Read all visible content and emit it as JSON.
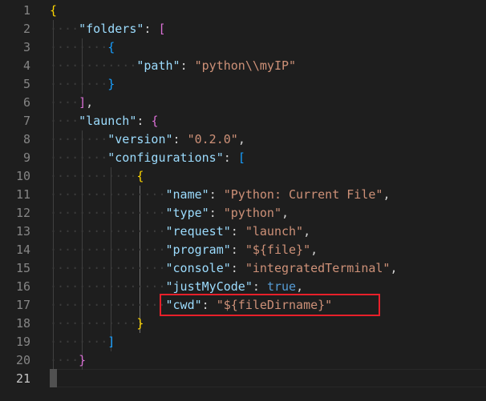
{
  "editor": {
    "lines": [
      {
        "num": "1",
        "tokens": [
          {
            "t": "{",
            "c": "b1"
          }
        ]
      },
      {
        "num": "2",
        "tokens": [
          {
            "t": "····",
            "c": "ws"
          },
          {
            "t": "\"folders\"",
            "c": "key"
          },
          {
            "t": ": ",
            "c": "punc"
          },
          {
            "t": "[",
            "c": "b2"
          }
        ]
      },
      {
        "num": "3",
        "tokens": [
          {
            "t": "········",
            "c": "ws"
          },
          {
            "t": "{",
            "c": "b3"
          }
        ]
      },
      {
        "num": "4",
        "tokens": [
          {
            "t": "············",
            "c": "ws"
          },
          {
            "t": "\"path\"",
            "c": "key"
          },
          {
            "t": ": ",
            "c": "punc"
          },
          {
            "t": "\"python\\\\myIP\"",
            "c": "str"
          }
        ]
      },
      {
        "num": "5",
        "tokens": [
          {
            "t": "········",
            "c": "ws"
          },
          {
            "t": "}",
            "c": "b3"
          }
        ]
      },
      {
        "num": "6",
        "tokens": [
          {
            "t": "····",
            "c": "ws"
          },
          {
            "t": "]",
            "c": "b2"
          },
          {
            "t": ",",
            "c": "punc"
          }
        ]
      },
      {
        "num": "7",
        "tokens": [
          {
            "t": "····",
            "c": "ws"
          },
          {
            "t": "\"launch\"",
            "c": "key"
          },
          {
            "t": ": ",
            "c": "punc"
          },
          {
            "t": "{",
            "c": "b2"
          }
        ]
      },
      {
        "num": "8",
        "tokens": [
          {
            "t": "········",
            "c": "ws"
          },
          {
            "t": "\"version\"",
            "c": "key"
          },
          {
            "t": ": ",
            "c": "punc"
          },
          {
            "t": "\"0.2.0\"",
            "c": "str"
          },
          {
            "t": ",",
            "c": "punc"
          }
        ]
      },
      {
        "num": "9",
        "tokens": [
          {
            "t": "········",
            "c": "ws"
          },
          {
            "t": "\"configurations\"",
            "c": "key"
          },
          {
            "t": ": ",
            "c": "punc"
          },
          {
            "t": "[",
            "c": "b3"
          }
        ]
      },
      {
        "num": "10",
        "tokens": [
          {
            "t": "············",
            "c": "ws"
          },
          {
            "t": "{",
            "c": "b1"
          }
        ]
      },
      {
        "num": "11",
        "tokens": [
          {
            "t": "················",
            "c": "ws"
          },
          {
            "t": "\"name\"",
            "c": "key"
          },
          {
            "t": ": ",
            "c": "punc"
          },
          {
            "t": "\"Python: Current File\"",
            "c": "str"
          },
          {
            "t": ",",
            "c": "punc"
          }
        ]
      },
      {
        "num": "12",
        "tokens": [
          {
            "t": "················",
            "c": "ws"
          },
          {
            "t": "\"type\"",
            "c": "key"
          },
          {
            "t": ": ",
            "c": "punc"
          },
          {
            "t": "\"python\"",
            "c": "str"
          },
          {
            "t": ",",
            "c": "punc"
          }
        ]
      },
      {
        "num": "13",
        "tokens": [
          {
            "t": "················",
            "c": "ws"
          },
          {
            "t": "\"request\"",
            "c": "key"
          },
          {
            "t": ": ",
            "c": "punc"
          },
          {
            "t": "\"launch\"",
            "c": "str"
          },
          {
            "t": ",",
            "c": "punc"
          }
        ]
      },
      {
        "num": "14",
        "tokens": [
          {
            "t": "················",
            "c": "ws"
          },
          {
            "t": "\"program\"",
            "c": "key"
          },
          {
            "t": ": ",
            "c": "punc"
          },
          {
            "t": "\"${file}\"",
            "c": "str"
          },
          {
            "t": ",",
            "c": "punc"
          }
        ]
      },
      {
        "num": "15",
        "tokens": [
          {
            "t": "················",
            "c": "ws"
          },
          {
            "t": "\"console\"",
            "c": "key"
          },
          {
            "t": ": ",
            "c": "punc"
          },
          {
            "t": "\"integratedTerminal\"",
            "c": "str"
          },
          {
            "t": ",",
            "c": "punc"
          }
        ]
      },
      {
        "num": "16",
        "tokens": [
          {
            "t": "················",
            "c": "ws"
          },
          {
            "t": "\"justMyCode\"",
            "c": "key"
          },
          {
            "t": ": ",
            "c": "punc"
          },
          {
            "t": "true",
            "c": "kw"
          },
          {
            "t": ",",
            "c": "punc"
          }
        ]
      },
      {
        "num": "17",
        "tokens": [
          {
            "t": "················",
            "c": "ws"
          },
          {
            "t": "\"cwd\"",
            "c": "key"
          },
          {
            "t": ": ",
            "c": "punc"
          },
          {
            "t": "\"${fileDirname}\"",
            "c": "str"
          }
        ]
      },
      {
        "num": "18",
        "tokens": [
          {
            "t": "············",
            "c": "ws"
          },
          {
            "t": "}",
            "c": "b1"
          }
        ]
      },
      {
        "num": "19",
        "tokens": [
          {
            "t": "········",
            "c": "ws"
          },
          {
            "t": "]",
            "c": "b3"
          }
        ]
      },
      {
        "num": "20",
        "tokens": [
          {
            "t": "····",
            "c": "ws"
          },
          {
            "t": "}",
            "c": "b2"
          }
        ]
      },
      {
        "num": "21",
        "tokens": [
          {
            "t": "}",
            "c": "b1"
          }
        ]
      }
    ],
    "active_line": "21",
    "highlight_color": "#e8202a"
  }
}
